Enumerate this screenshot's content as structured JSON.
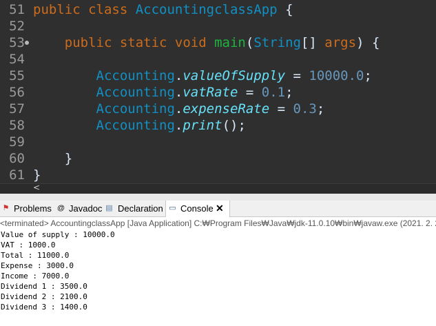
{
  "editor": {
    "lines": [
      {
        "num": "51",
        "tokens": [
          {
            "t": "public class ",
            "c": "kw"
          },
          {
            "t": "AccountingclassApp",
            "c": "cls"
          },
          {
            "t": " {",
            "c": "plain"
          }
        ]
      },
      {
        "num": "52",
        "tokens": []
      },
      {
        "num": "53",
        "tokens": [
          {
            "t": "    public static void ",
            "c": "kw"
          },
          {
            "t": "main",
            "c": "meth"
          },
          {
            "t": "(",
            "c": "plain"
          },
          {
            "t": "String",
            "c": "cls"
          },
          {
            "t": "[] ",
            "c": "plain"
          },
          {
            "t": "args",
            "c": "kw"
          },
          {
            "t": ") {",
            "c": "plain"
          }
        ]
      },
      {
        "num": "54",
        "tokens": []
      },
      {
        "num": "55",
        "tokens": [
          {
            "t": "        ",
            "c": "plain"
          },
          {
            "t": "Accounting",
            "c": "cls"
          },
          {
            "t": ".",
            "c": "plain"
          },
          {
            "t": "valueOfSupply",
            "c": "field"
          },
          {
            "t": " = ",
            "c": "plain"
          },
          {
            "t": "10000.0",
            "c": "num"
          },
          {
            "t": ";",
            "c": "plain"
          }
        ]
      },
      {
        "num": "56",
        "tokens": [
          {
            "t": "        ",
            "c": "plain"
          },
          {
            "t": "Accounting",
            "c": "cls"
          },
          {
            "t": ".",
            "c": "plain"
          },
          {
            "t": "vatRate",
            "c": "field"
          },
          {
            "t": " = ",
            "c": "plain"
          },
          {
            "t": "0.1",
            "c": "num"
          },
          {
            "t": ";",
            "c": "plain"
          }
        ]
      },
      {
        "num": "57",
        "tokens": [
          {
            "t": "        ",
            "c": "plain"
          },
          {
            "t": "Accounting",
            "c": "cls"
          },
          {
            "t": ".",
            "c": "plain"
          },
          {
            "t": "expenseRate",
            "c": "field"
          },
          {
            "t": " = ",
            "c": "plain"
          },
          {
            "t": "0.3",
            "c": "num"
          },
          {
            "t": ";",
            "c": "plain"
          }
        ]
      },
      {
        "num": "58",
        "tokens": [
          {
            "t": "        ",
            "c": "plain"
          },
          {
            "t": "Accounting",
            "c": "cls"
          },
          {
            "t": ".",
            "c": "plain"
          },
          {
            "t": "print",
            "c": "field"
          },
          {
            "t": "();",
            "c": "plain"
          }
        ]
      },
      {
        "num": "59",
        "tokens": []
      },
      {
        "num": "60",
        "tokens": [
          {
            "t": "    }",
            "c": "plain"
          }
        ]
      },
      {
        "num": "61",
        "tokens": [
          {
            "t": "}",
            "c": "plain"
          }
        ]
      }
    ],
    "scroll_left_glyph": "<"
  },
  "tabs": [
    {
      "label": "Problems",
      "icon": "problems-icon",
      "glyph": "⚑"
    },
    {
      "label": "Javadoc",
      "icon": "javadoc-icon",
      "glyph": "@"
    },
    {
      "label": "Declaration",
      "icon": "declaration-icon",
      "glyph": "▤"
    },
    {
      "label": "Console",
      "icon": "console-icon",
      "glyph": "▭",
      "active": true
    }
  ],
  "console": {
    "status": "<terminated> AccountingclassApp [Java Application] C:₩Program Files₩Java₩jdk-11.0.10₩bin₩javaw.exe  (2021. 2. 2",
    "output": [
      "Value of supply : 10000.0",
      "VAT : 1000.0",
      "Total : 11000.0",
      "Expense : 3000.0",
      "Income : 7000.0",
      "Dividend 1 : 3500.0",
      "Dividend 2 : 2100.0",
      "Dividend 3 : 1400.0"
    ]
  }
}
